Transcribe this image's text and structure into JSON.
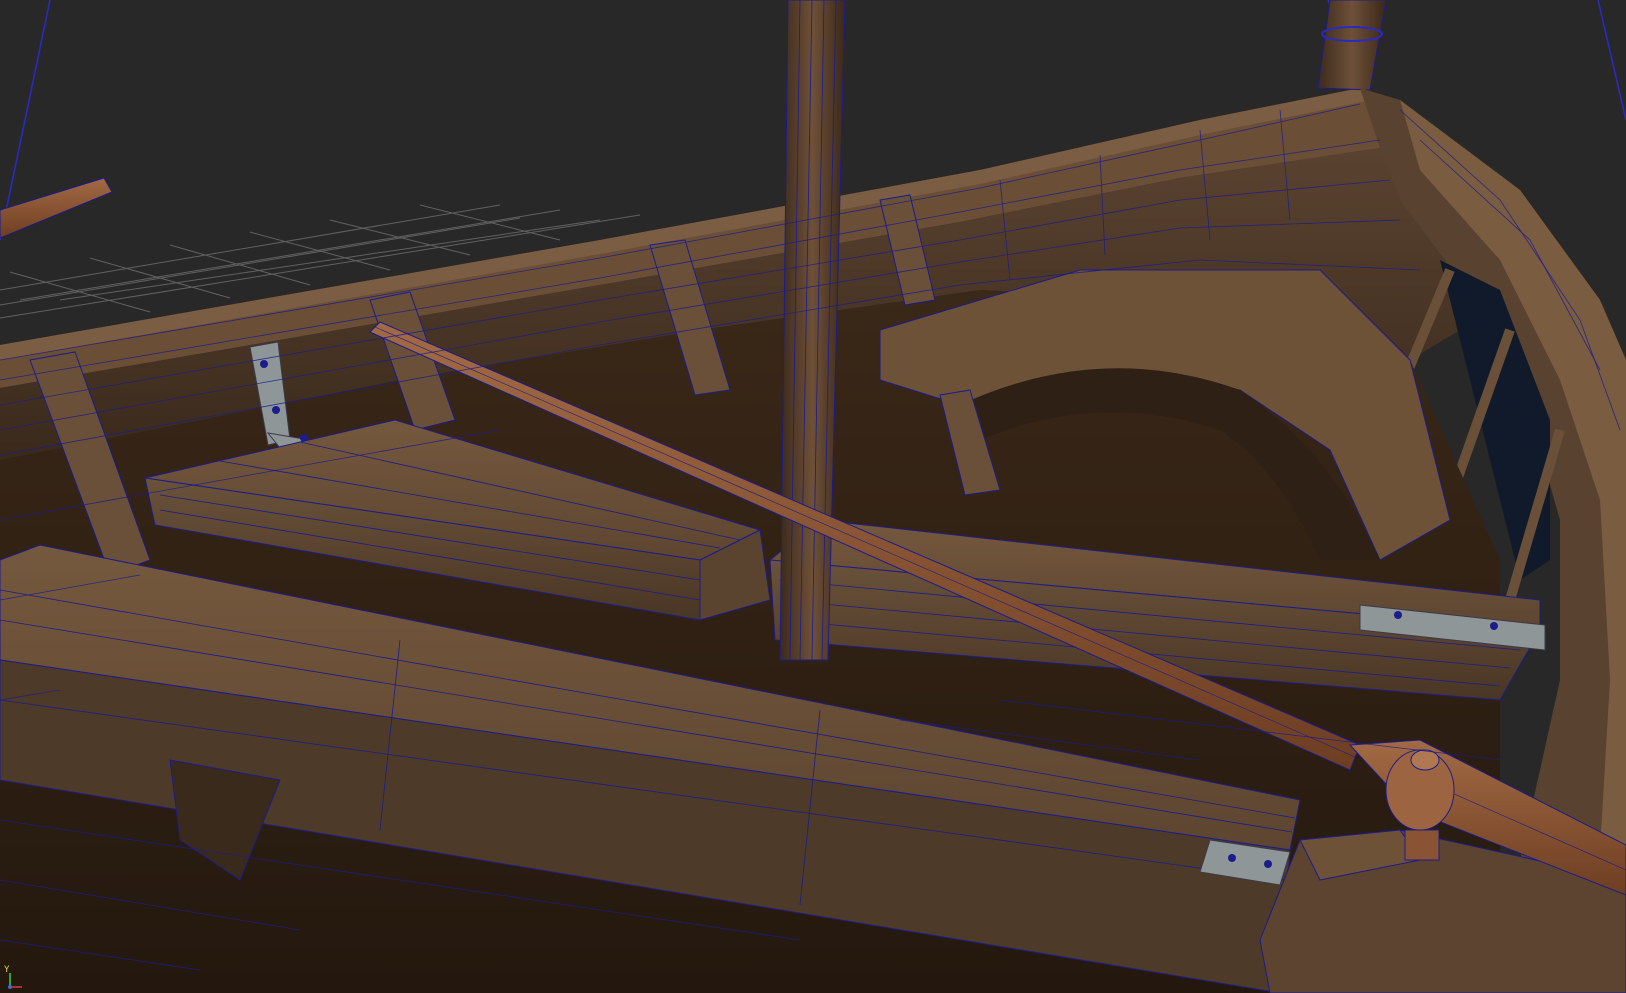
{
  "app": {
    "view": "3d-viewport",
    "display_mode": "textured-wireframe-on-shaded"
  },
  "scene": {
    "object": "wooden-rowboat",
    "parts": [
      "hull",
      "mast",
      "thwart-seats",
      "oar",
      "oarlock",
      "knee-brackets",
      "stern-seat",
      "ribs",
      "rigging-lines"
    ]
  },
  "colors": {
    "background": "#282828",
    "wood_dark": "#3a2a1c",
    "wood_mid": "#5e4530",
    "wood_light": "#7a5d40",
    "oar": "#8a5434",
    "wire": "#1c1c8c",
    "grid": "#6a6a6a",
    "metal": "#8e9698"
  },
  "axis_gizmo": {
    "y_label": "Y"
  }
}
